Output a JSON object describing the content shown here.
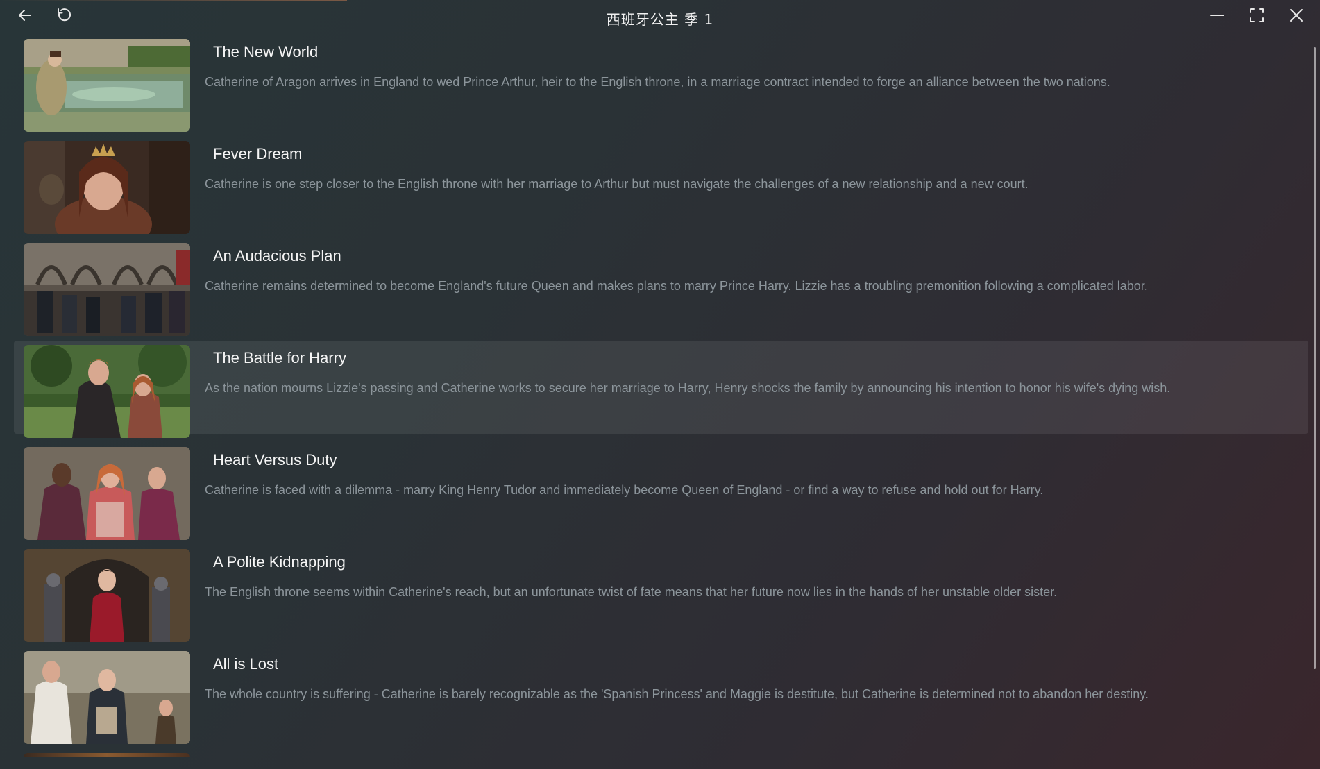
{
  "window": {
    "title": "西班牙公主 季 1"
  },
  "titlebar": {
    "back_icon": "back-arrow-icon",
    "refresh_icon": "refresh-icon",
    "minimize_icon": "minimize-icon",
    "fullscreen_icon": "fullscreen-icon",
    "close_icon": "close-icon"
  },
  "episodes": [
    {
      "title": "The New World",
      "description": "Catherine of Aragon arrives in England to wed Prince Arthur, heir to the English throne, in a marriage contract intended to forge an alliance between the two nations."
    },
    {
      "title": "Fever Dream",
      "description": "Catherine is one step closer to the English throne with her marriage to Arthur but must navigate the challenges of a new relationship and a new court."
    },
    {
      "title": "An Audacious Plan",
      "description": "Catherine remains determined to become England's future Queen and makes plans to marry Prince Harry. Lizzie has a troubling premonition following a complicated labor."
    },
    {
      "title": "The Battle for Harry",
      "description": "As the nation mourns Lizzie's passing and Catherine works to secure her marriage to Harry, Henry shocks the family by announcing his intention to honor his wife's dying wish.",
      "selected": true
    },
    {
      "title": "Heart Versus Duty",
      "description": "Catherine is faced with a dilemma - marry King Henry Tudor and immediately become Queen of England - or find a way to refuse and hold out for Harry."
    },
    {
      "title": "A Polite Kidnapping",
      "description": "The English throne seems within Catherine's reach, but an unfortunate twist of fate means that her future now lies in the hands of her unstable older sister."
    },
    {
      "title": "All is Lost",
      "description": "The whole country is suffering - Catherine is barely recognizable as the 'Spanish Princess' and Maggie is destitute, but Catherine is determined not to abandon her destiny."
    }
  ]
}
